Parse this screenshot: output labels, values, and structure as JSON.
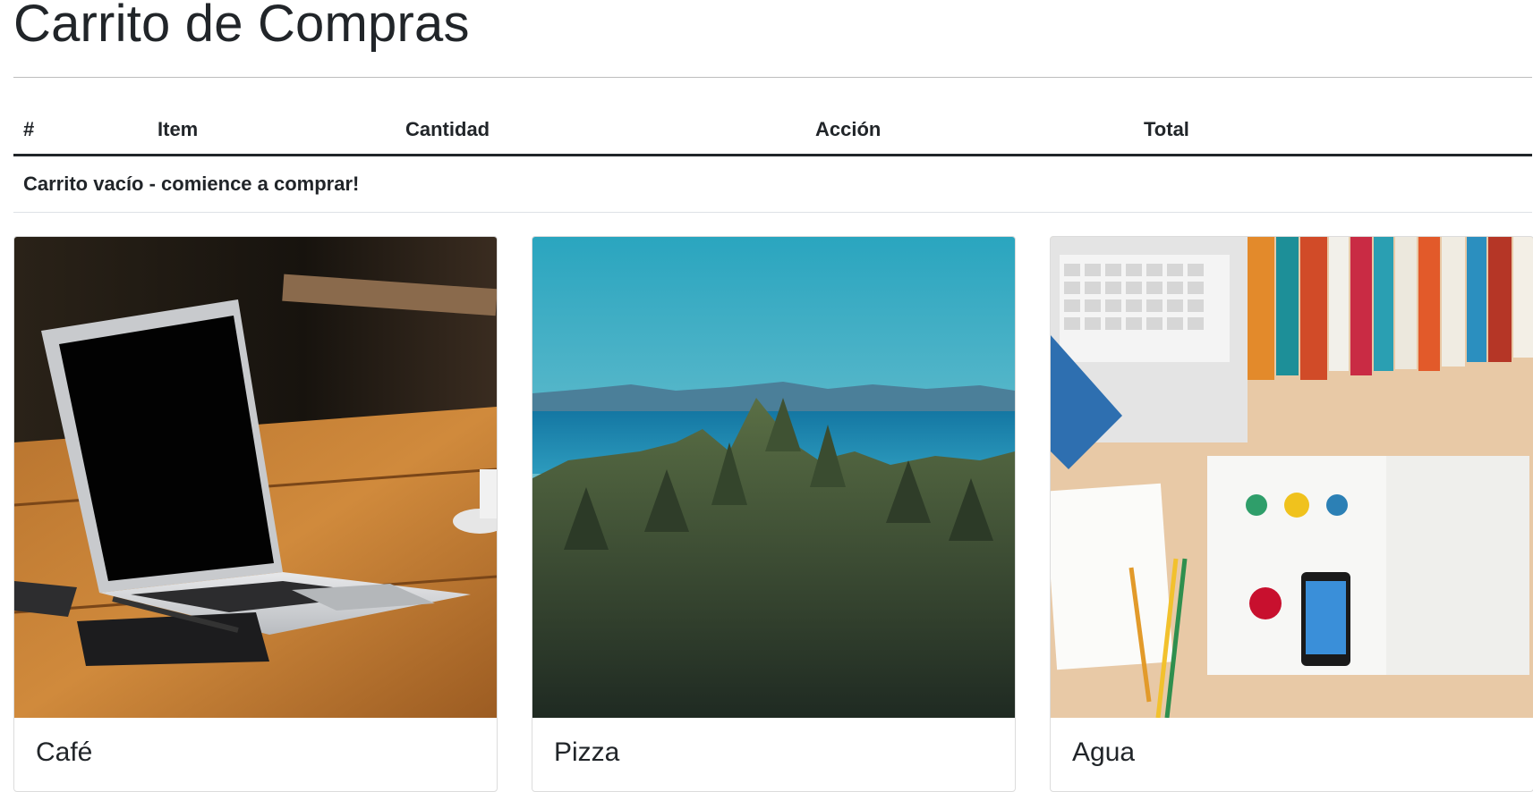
{
  "page": {
    "title": "Carrito de Compras"
  },
  "cart": {
    "columns": [
      "#",
      "Item",
      "Cantidad",
      "Acción",
      "Total"
    ],
    "empty_message": "Carrito vacío - comience a comprar!"
  },
  "products": [
    {
      "name": "Café",
      "image_icon": "laptop-on-table-photo"
    },
    {
      "name": "Pizza",
      "image_icon": "forest-sea-landscape-photo"
    },
    {
      "name": "Agua",
      "image_icon": "desk-books-notebook-photo"
    }
  ]
}
